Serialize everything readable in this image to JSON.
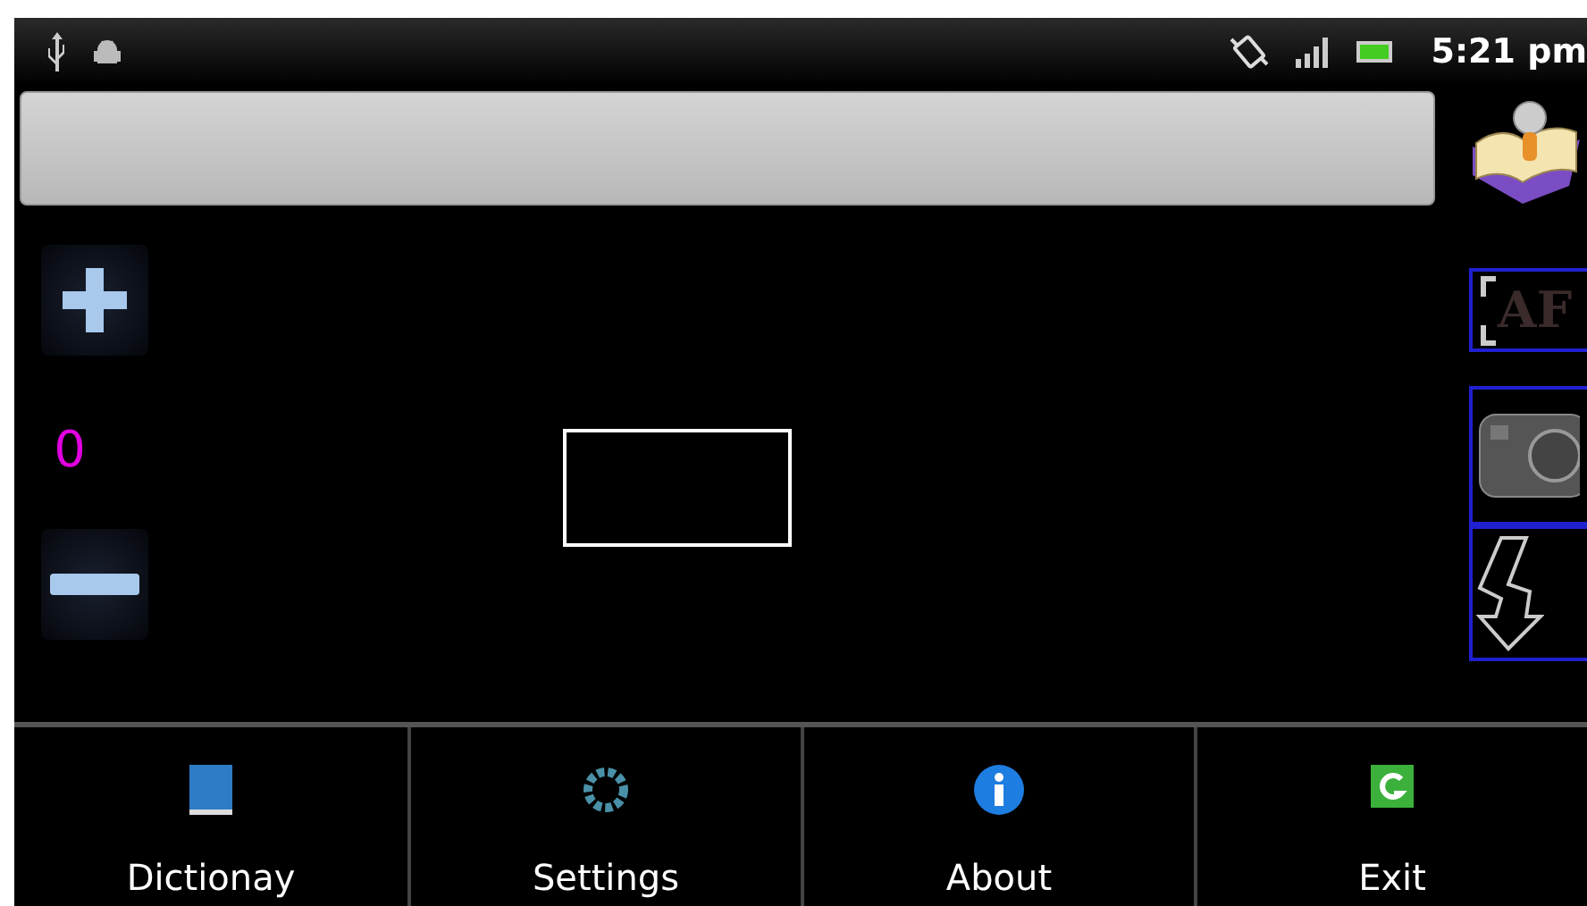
{
  "status_bar": {
    "time": "5:21 pm"
  },
  "zoom": {
    "value": "0"
  },
  "side_buttons": [
    {
      "kind": "dictionary"
    },
    {
      "kind": "autofocus",
      "label": "AF"
    },
    {
      "kind": "camera"
    },
    {
      "kind": "flash"
    }
  ],
  "menu": [
    {
      "kind": "dictionary",
      "label": "Dictionay"
    },
    {
      "kind": "settings",
      "label": "Settings"
    },
    {
      "kind": "about",
      "label": "About"
    },
    {
      "kind": "exit",
      "label": "Exit"
    }
  ]
}
